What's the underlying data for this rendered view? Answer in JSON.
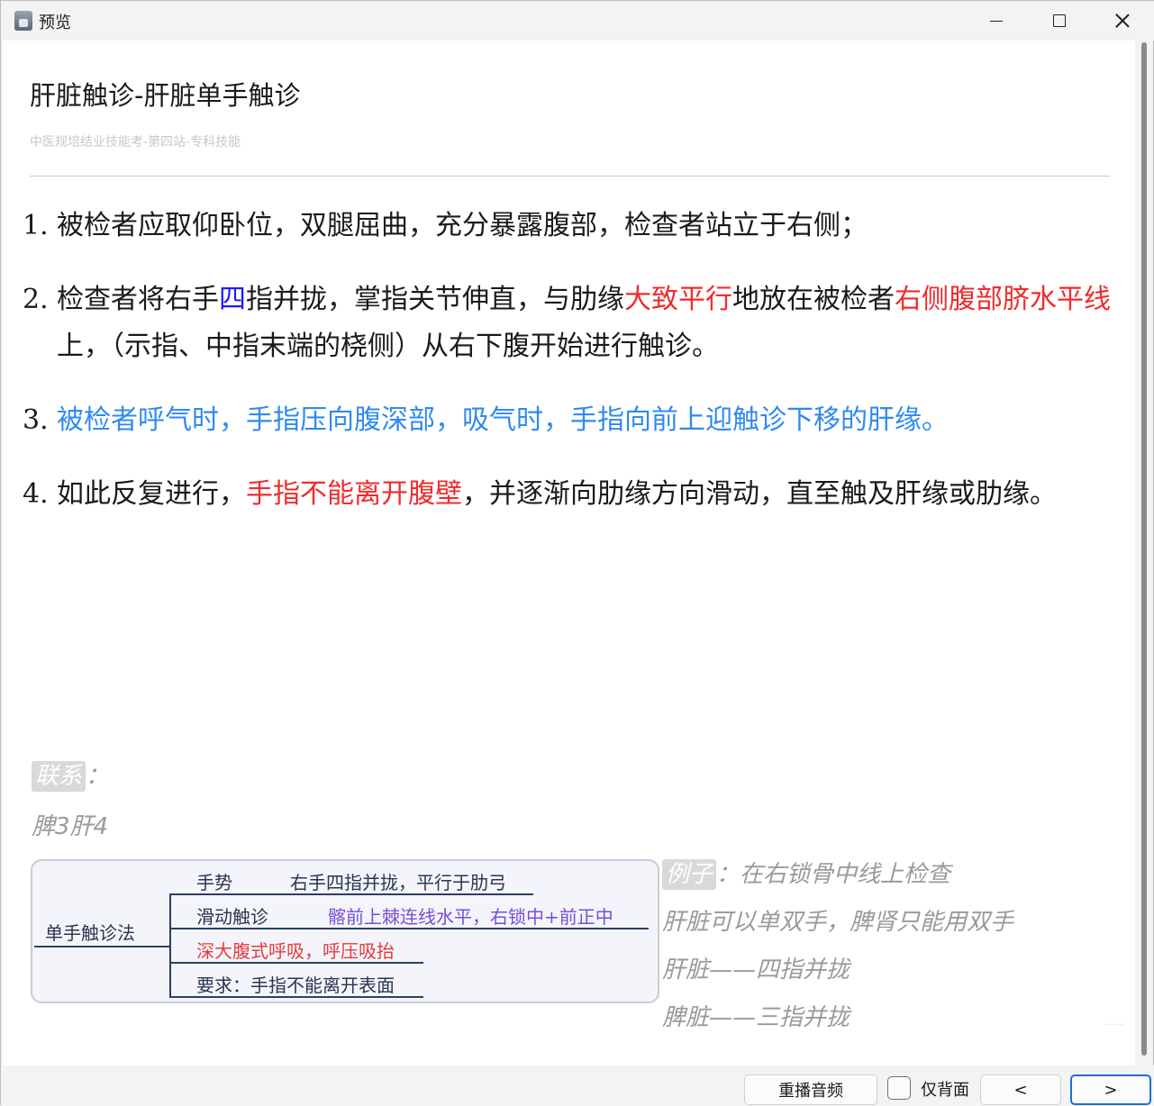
{
  "window": {
    "title": "预览",
    "minimize_glyph": "minimize-icon",
    "maximize_glyph": "maximize-icon",
    "close_glyph": "close-icon"
  },
  "card": {
    "title": "肝脏触诊-肝脏单手触诊",
    "subtitle": "中医规培结业技能考-第四站-专科技能"
  },
  "steps": {
    "s1": {
      "num": "1.",
      "text": "被检者应取仰卧位，双腿屈曲，充分暴露腹部，检查者站立于右侧；"
    },
    "s2": {
      "num": "2.",
      "p1": "检查者将右手",
      "p2": "四",
      "p3": "指并拢，掌指关节伸直，与肋缘",
      "p4": "大致平行",
      "p5": "地放在被检者",
      "p6": "右侧腹部脐水平线",
      "p7": "上，（示指、中指末端的桡侧）从右下腹开始进行触诊。"
    },
    "s3": {
      "num": "3.",
      "text": "被检者呼气时，手指压向腹深部，吸气时，手指向前上迎触诊下移的肝缘。"
    },
    "s4": {
      "num": "4.",
      "p1": "如此反复进行，",
      "p2": "手指不能离开腹壁",
      "p3": "，并逐渐向肋缘方向滑动，直至触及肝缘或肋缘。"
    }
  },
  "notes": {
    "lianxi_tag": "联系",
    "lianxi_colon": "：",
    "lianxi_text": "脾3肝4",
    "example_tag": "例子",
    "example_colon": "：",
    "example_line1": "在右锁骨中线上检查",
    "example_line2": "肝脏可以单双手，脾肾只能用双手",
    "example_line3": "肝脏——四指并拢",
    "example_line4": "脾脏——三指并拢",
    "dots": "....."
  },
  "mindmap": {
    "root": "单手触诊法",
    "items": [
      {
        "label": "手势",
        "value": "右手四指并拢，平行于肋弓"
      },
      {
        "label": "滑动触诊",
        "value": "髂前上棘连线水平，右锁中+前正中"
      },
      {
        "label": "深大腹式呼吸，呼压吸抬",
        "value": ""
      },
      {
        "label": "要求：手指不能离开表面",
        "value": ""
      }
    ]
  },
  "footer": {
    "replay_label": "重播音频",
    "back_only_label": "仅背面",
    "back_only_checked": false,
    "prev_label": "<",
    "next_label": ">"
  },
  "colors": {
    "red": "#f02b2b",
    "blue": "#1a1aff",
    "light_blue": "#2f8af0",
    "accent": "#1f6fd1"
  }
}
